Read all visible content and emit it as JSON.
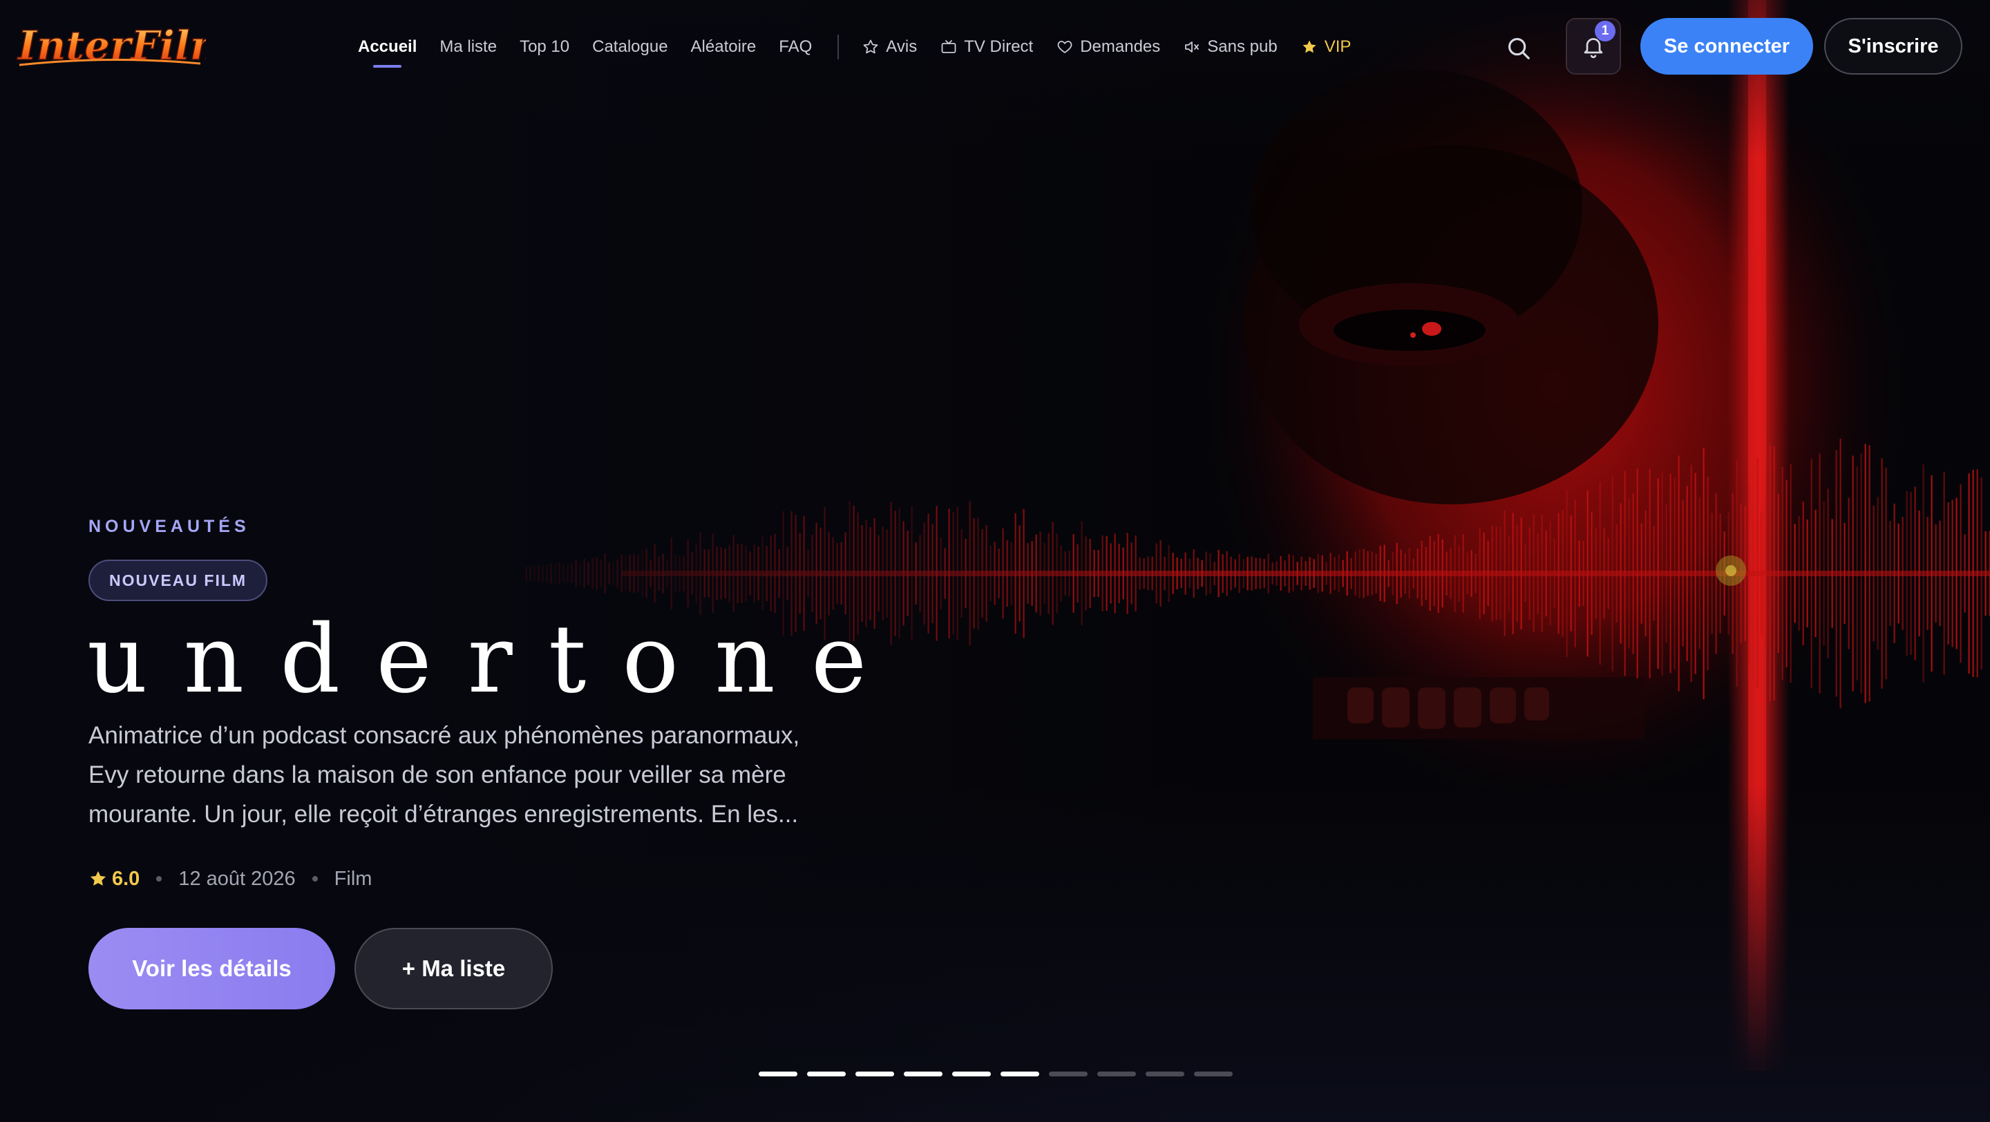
{
  "brand": {
    "logo_text": "InterFilm"
  },
  "nav": {
    "links": [
      {
        "label": "Accueil",
        "active": true
      },
      {
        "label": "Ma liste"
      },
      {
        "label": "Top 10"
      },
      {
        "label": "Catalogue"
      },
      {
        "label": "Aléatoire"
      },
      {
        "label": "FAQ"
      }
    ],
    "extras": [
      {
        "label": "Avis",
        "icon": "star-outline-icon"
      },
      {
        "label": "TV Direct",
        "icon": "tv-icon"
      },
      {
        "label": "Demandes",
        "icon": "heart-icon"
      },
      {
        "label": "Sans pub",
        "icon": "mute-icon"
      },
      {
        "label": "VIP",
        "icon": "star-filled-icon"
      }
    ]
  },
  "header": {
    "notifications_count": "1",
    "login_label": "Se connecter",
    "signup_label": "S'inscrire"
  },
  "hero": {
    "eyebrow": "NOUVEAUTÉS",
    "tag": "NOUVEAU FILM",
    "title": "undertone",
    "synopsis": "Animatrice d’un podcast consacré aux phénomènes paranormaux, Evy retourne dans la maison de son enfance pour veiller sa mère mourante. Un jour, elle reçoit d’étranges enregistrements. En les...",
    "rating": "6.0",
    "date": "12 août 2026",
    "kind": "Film",
    "details_label": "Voir les détails",
    "list_label": "+ Ma liste",
    "slides_total": 10,
    "slides_viewed": 6
  },
  "colors": {
    "accent": "#7b7cf0",
    "login": "#3b82f6",
    "vip": "#f2c94c",
    "poster_red": "#c01010"
  }
}
